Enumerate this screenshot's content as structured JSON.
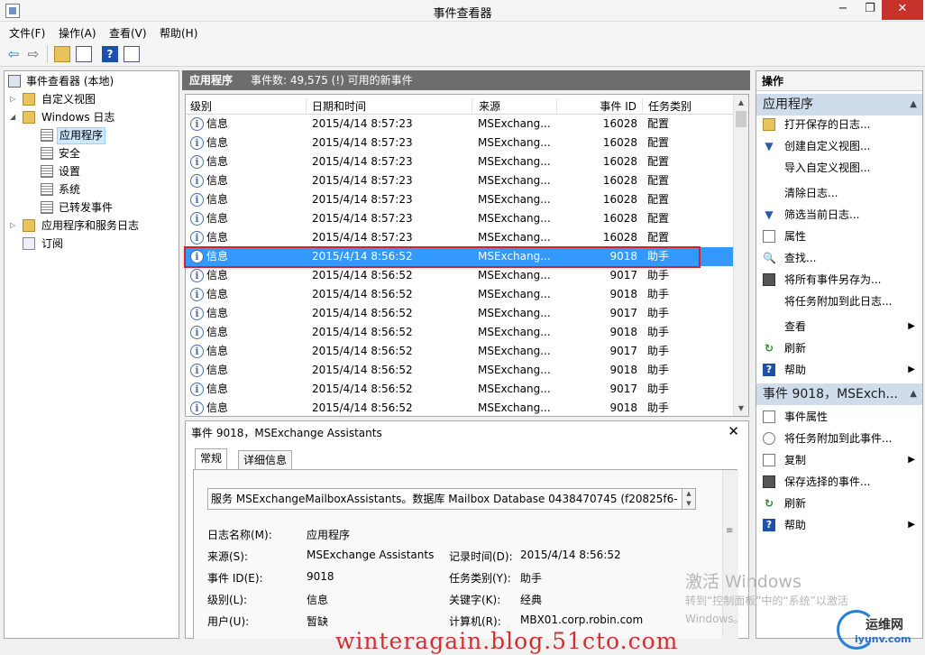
{
  "window": {
    "title": "事件查看器",
    "min": "−",
    "max": "❐",
    "close": "✕"
  },
  "menu": [
    "文件(F)",
    "操作(A)",
    "查看(V)",
    "帮助(H)"
  ],
  "tree": [
    {
      "label": "事件查看器 (本地)",
      "level": 0,
      "icon": "viewer-icon",
      "expander": ""
    },
    {
      "label": "自定义视图",
      "level": 1,
      "icon": "folder-icon",
      "expander": "▷"
    },
    {
      "label": "Windows 日志",
      "level": 1,
      "icon": "folder-icon",
      "expander": "◢"
    },
    {
      "label": "应用程序",
      "level": 2,
      "icon": "log-icon",
      "expander": "",
      "selected": true
    },
    {
      "label": "安全",
      "level": 2,
      "icon": "log-icon",
      "expander": ""
    },
    {
      "label": "设置",
      "level": 2,
      "icon": "log-icon",
      "expander": ""
    },
    {
      "label": "系统",
      "level": 2,
      "icon": "log-icon",
      "expander": ""
    },
    {
      "label": "已转发事件",
      "level": 2,
      "icon": "log-icon",
      "expander": ""
    },
    {
      "label": "应用程序和服务日志",
      "level": 1,
      "icon": "folder-icon",
      "expander": "▷"
    },
    {
      "label": "订阅",
      "level": 1,
      "icon": "subscription-icon",
      "expander": ""
    }
  ],
  "center": {
    "log_name": "应用程序",
    "summary": "事件数: 49,575 (!) 可用的新事件",
    "columns": [
      "级别",
      "日期和时间",
      "来源",
      "事件 ID",
      "任务类别"
    ],
    "rows": [
      {
        "level": "信息",
        "date": "2015/4/14 8:57:23",
        "source": "MSExchang...",
        "id": "16028",
        "task": "配置"
      },
      {
        "level": "信息",
        "date": "2015/4/14 8:57:23",
        "source": "MSExchang...",
        "id": "16028",
        "task": "配置"
      },
      {
        "level": "信息",
        "date": "2015/4/14 8:57:23",
        "source": "MSExchang...",
        "id": "16028",
        "task": "配置"
      },
      {
        "level": "信息",
        "date": "2015/4/14 8:57:23",
        "source": "MSExchang...",
        "id": "16028",
        "task": "配置"
      },
      {
        "level": "信息",
        "date": "2015/4/14 8:57:23",
        "source": "MSExchang...",
        "id": "16028",
        "task": "配置"
      },
      {
        "level": "信息",
        "date": "2015/4/14 8:57:23",
        "source": "MSExchang...",
        "id": "16028",
        "task": "配置"
      },
      {
        "level": "信息",
        "date": "2015/4/14 8:57:23",
        "source": "MSExchang...",
        "id": "16028",
        "task": "配置"
      },
      {
        "level": "信息",
        "date": "2015/4/14 8:56:52",
        "source": "MSExchang...",
        "id": "9018",
        "task": "助手",
        "selected": true
      },
      {
        "level": "信息",
        "date": "2015/4/14 8:56:52",
        "source": "MSExchang...",
        "id": "9017",
        "task": "助手"
      },
      {
        "level": "信息",
        "date": "2015/4/14 8:56:52",
        "source": "MSExchang...",
        "id": "9018",
        "task": "助手"
      },
      {
        "level": "信息",
        "date": "2015/4/14 8:56:52",
        "source": "MSExchang...",
        "id": "9017",
        "task": "助手"
      },
      {
        "level": "信息",
        "date": "2015/4/14 8:56:52",
        "source": "MSExchang...",
        "id": "9018",
        "task": "助手"
      },
      {
        "level": "信息",
        "date": "2015/4/14 8:56:52",
        "source": "MSExchang...",
        "id": "9017",
        "task": "助手"
      },
      {
        "level": "信息",
        "date": "2015/4/14 8:56:52",
        "source": "MSExchang...",
        "id": "9018",
        "task": "助手"
      },
      {
        "level": "信息",
        "date": "2015/4/14 8:56:52",
        "source": "MSExchang...",
        "id": "9017",
        "task": "助手"
      },
      {
        "level": "信息",
        "date": "2015/4/14 8:56:52",
        "source": "MSExchang...",
        "id": "9018",
        "task": "助手"
      }
    ]
  },
  "detail": {
    "title": "事件 9018，MSExchange Assistants",
    "close": "✕",
    "tabs": [
      "常规",
      "详细信息"
    ],
    "description": "服务 MSExchangeMailboxAssistants。数据库 Mailbox Database 0438470745 (f20825f6-",
    "fields": [
      {
        "label": "日志名称(M):",
        "value": "应用程序"
      },
      {
        "label": "来源(S):",
        "value": "MSExchange Assistants"
      },
      {
        "label": "事件 ID(E):",
        "value": "9018"
      },
      {
        "label": "级别(L):",
        "value": "信息"
      },
      {
        "label": "用户(U):",
        "value": "暂缺"
      }
    ],
    "fields_right": [
      {
        "label": "记录时间(D):",
        "value": "2015/4/14 8:56:52"
      },
      {
        "label": "任务类别(Y):",
        "value": "助手"
      },
      {
        "label": "关键字(K):",
        "value": "经典"
      },
      {
        "label": "计算机(R):",
        "value": "MBX01.corp.robin.com"
      }
    ]
  },
  "actions": {
    "header": "操作",
    "section1": "应用程序",
    "items1": [
      {
        "label": "打开保存的日志...",
        "icon": "folder-open-icon",
        "glyph": "",
        "arrow": ""
      },
      {
        "label": "创建自定义视图...",
        "icon": "filter-icon",
        "glyph": "▼",
        "arrow": ""
      },
      {
        "label": "导入自定义视图...",
        "icon": "",
        "glyph": "",
        "arrow": ""
      },
      {
        "label": "清除日志...",
        "icon": "",
        "glyph": "",
        "arrow": ""
      },
      {
        "label": "筛选当前日志...",
        "icon": "filter-icon",
        "glyph": "▼",
        "arrow": ""
      },
      {
        "label": "属性",
        "icon": "properties-icon",
        "glyph": "",
        "arrow": ""
      },
      {
        "label": "查找...",
        "icon": "find-icon",
        "glyph": "🔍",
        "arrow": ""
      },
      {
        "label": "将所有事件另存为...",
        "icon": "save-icon",
        "glyph": "",
        "arrow": ""
      },
      {
        "label": "将任务附加到此日志...",
        "icon": "",
        "glyph": "",
        "arrow": ""
      },
      {
        "label": "查看",
        "icon": "",
        "glyph": "",
        "arrow": "▶"
      },
      {
        "label": "刷新",
        "icon": "refresh-icon",
        "glyph": "↻",
        "arrow": ""
      },
      {
        "label": "帮助",
        "icon": "help-icon",
        "glyph": "?",
        "arrow": "▶"
      }
    ],
    "section2": "事件 9018，MSExch...",
    "items2": [
      {
        "label": "事件属性",
        "icon": "properties-icon",
        "glyph": "",
        "arrow": ""
      },
      {
        "label": "将任务附加到此事件...",
        "icon": "task-icon",
        "glyph": "",
        "arrow": ""
      },
      {
        "label": "复制",
        "icon": "copy-icon",
        "glyph": "",
        "arrow": "▶"
      },
      {
        "label": "保存选择的事件...",
        "icon": "save-icon",
        "glyph": "",
        "arrow": ""
      },
      {
        "label": "刷新",
        "icon": "refresh-icon",
        "glyph": "↻",
        "arrow": ""
      },
      {
        "label": "帮助",
        "icon": "help-icon",
        "glyph": "?",
        "arrow": "▶"
      }
    ]
  },
  "overlay": {
    "activate_title": "激活 Windows",
    "activate_sub": "转到“控制面板”中的“系统”以激活",
    "activate_sub2": "Windows。",
    "watermark": "winteragain.blog.51cto.com",
    "logo_text": "运维网",
    "logo_url": "iyunv.com"
  },
  "toolbar": {
    "back_glyph": "⇦",
    "forward_glyph": "⇨",
    "help_glyph": "?",
    "scroll_up": "▲",
    "scroll_down": "▼",
    "scroll_grip": "≡"
  }
}
